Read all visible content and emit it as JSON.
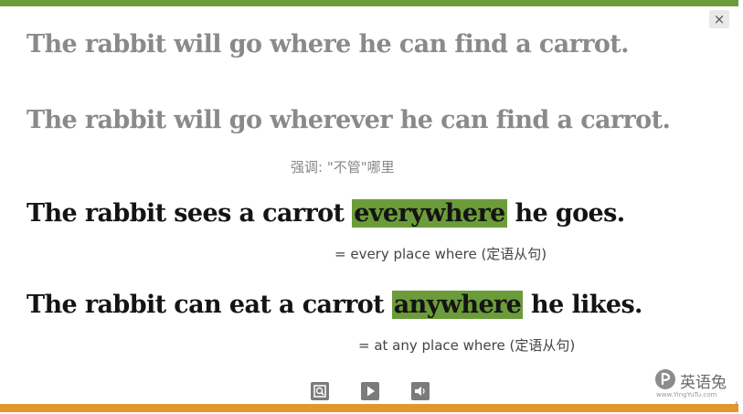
{
  "window": {
    "close_label": "×"
  },
  "sentences": [
    {
      "before": "The rabbit will go where he can find a carrot.",
      "highlight": "",
      "after": ""
    },
    {
      "before": "The rabbit will go wherever he can find a carrot.",
      "highlight": "",
      "after": ""
    },
    {
      "before": "The rabbit sees a carrot ",
      "highlight": "everywhere",
      "after": " he goes."
    },
    {
      "before": "The rabbit can eat a carrot ",
      "highlight": "anywhere",
      "after": " he likes."
    }
  ],
  "notes": {
    "emphasis": "强调: \"不管\"哪里",
    "everywhere_meaning": "= every place where (定语从句)",
    "anywhere_meaning": "= at any place where (定语从句)"
  },
  "controls": {
    "icons": [
      "zoom-icon",
      "play-icon",
      "volume-icon"
    ]
  },
  "logo": {
    "name": "英语兔",
    "url": "www.YingYuTu.com"
  },
  "edge": {
    "glyph": "‹"
  },
  "colors": {
    "highlight": "#6c9c3a",
    "top_bar": "#6c9c3a",
    "bottom_bar": "#e4962e",
    "faded_text": "#8a8a8a",
    "dark_text": "#141414"
  }
}
